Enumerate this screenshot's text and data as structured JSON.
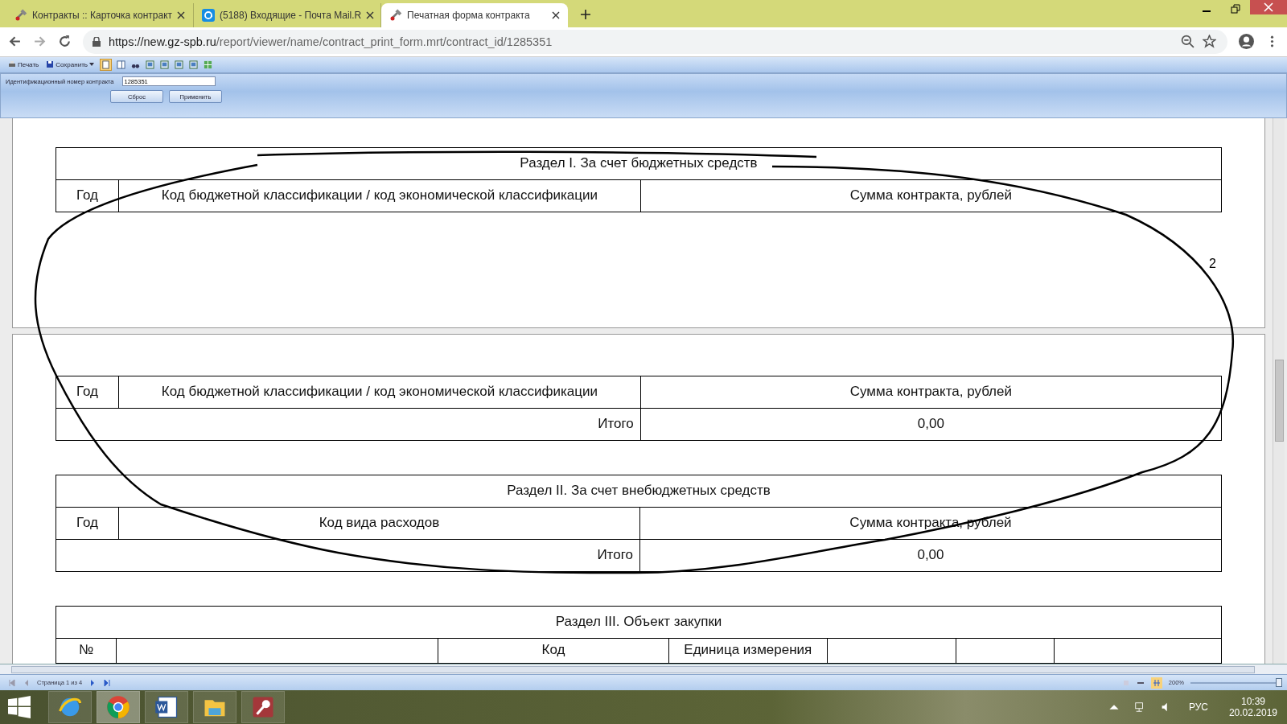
{
  "browser": {
    "tabs": [
      {
        "title": "Контракты :: Карточка контракт",
        "selected": false
      },
      {
        "title": "(5188) Входящие - Почта Mail.R",
        "selected": false
      },
      {
        "title": "Печатная форма контракта",
        "selected": true
      }
    ],
    "url": {
      "host": "https://new.gz-spb.ru",
      "path": "/report/viewer/name/contract_print_form.mrt/contract_id/1285351"
    }
  },
  "report_toolbar": {
    "print": "Печать",
    "save": "Сохранить"
  },
  "parameters": {
    "label": "Идентификационный номер контракта",
    "value": "1285351",
    "buttons": [
      "Сброс",
      "Применить"
    ]
  },
  "page_1": {
    "section_title": "Раздел I. За счет бюджетных средств",
    "columns": [
      "Год",
      "Код бюджетной классификации / код экономической классификации",
      "Сумма контракта, рублей"
    ],
    "page_number": "2"
  },
  "page_2": {
    "columns": [
      "Год",
      "Код бюджетной классификации / код экономической классификации",
      "Сумма контракта, рублей"
    ],
    "total": {
      "label": "Итого",
      "value": "0,00"
    },
    "section_2": {
      "title": "Раздел II. За счет внебюджетных средств",
      "columns": [
        "Год",
        "Код вида расходов",
        "Сумма контракта, рублей"
      ],
      "total": {
        "label": "Итого",
        "value": "0,00"
      }
    },
    "section_3": {
      "title": "Раздел III. Объект закупки",
      "columns": [
        "№",
        "",
        "Код",
        "Единица измерения",
        "",
        "",
        ""
      ]
    }
  },
  "status_bar": {
    "page": "Страница 1 из 4",
    "zoom": "200%",
    "zoom_slider": {
      "level": 1
    }
  },
  "taskbar": {
    "language": "РУС",
    "time": "10:39",
    "date": "20.02.2019"
  }
}
